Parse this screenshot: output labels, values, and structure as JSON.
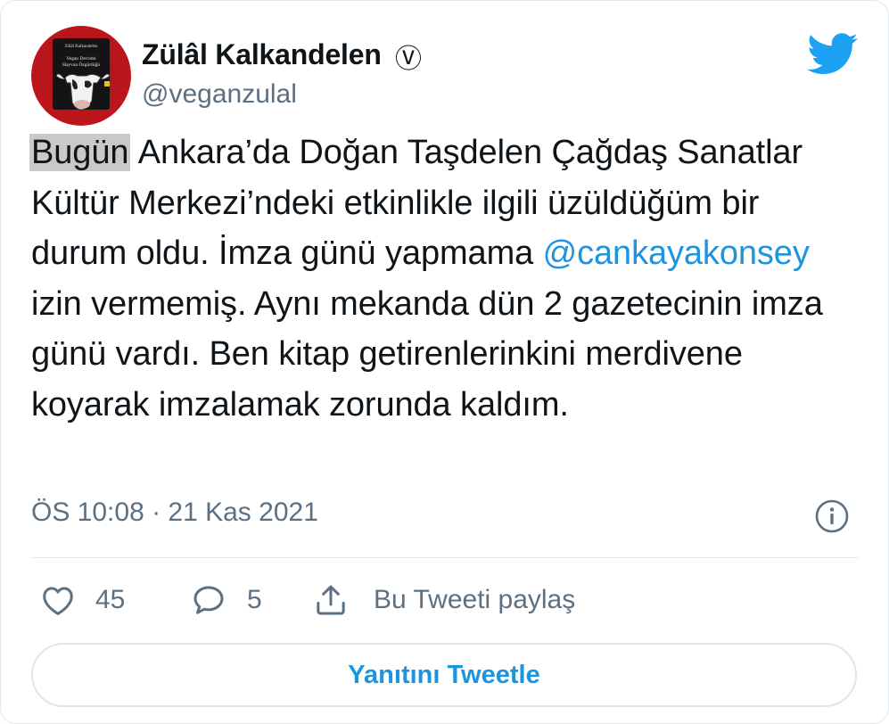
{
  "user": {
    "display_name": "Zülâl Kalkandelen",
    "verified_mark": "Ⓥ",
    "handle": "@veganzulal",
    "avatar_icon": "book-cover-cow-avatar",
    "avatar_text_top": "Zülâl Kalkandelen",
    "avatar_text_title_1": "Vegan Devrimi",
    "avatar_text_title_2": "Hayvan Özgürlüğü"
  },
  "tweet": {
    "highlighted_word": "Bugün",
    "text_part_1": " Ankara’da Doğan Taşdelen Çağdaş Sanatlar Kültür Merkezi’ndeki etkinlikle ilgili üzüldüğüm bir durum oldu. İmza günü yapmama ",
    "mention": "@cankayakonsey",
    "text_part_2": " izin vermemiş. Aynı mekanda dün 2 gazetecinin imza günü vardı. Ben kitap getirenlerinkini merdivene koyarak imzalamak zorunda kaldım."
  },
  "meta": {
    "timestamp": "ÖS 10:08 · 21 Kas 2021",
    "info_icon": "info-circle-icon"
  },
  "actions": {
    "like_count": "45",
    "reply_count": "5",
    "share_label": "Bu Tweeti paylaş"
  },
  "reply_button": {
    "label": "Yanıtını Tweetle"
  },
  "colors": {
    "accent": "#1b95e0",
    "text": "#0f1419",
    "secondary": "#5b7083",
    "twitter_blue": "#1da1f2",
    "highlight": "#c9c9c9"
  }
}
